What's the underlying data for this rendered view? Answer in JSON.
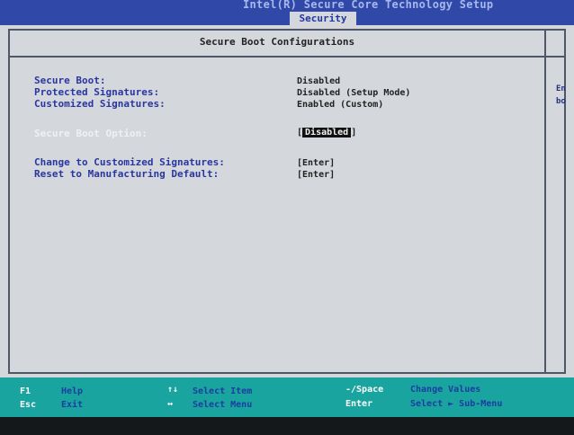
{
  "header": {
    "title": "Intel(R) Secure Core Technology Setup",
    "active_tab": "Security"
  },
  "section": {
    "title": "Secure Boot Configurations"
  },
  "info_rows": [
    {
      "label": "Secure Boot:",
      "value": "Disabled"
    },
    {
      "label": "Protected Signatures:",
      "value": "Disabled (Setup Mode)"
    },
    {
      "label": "Customized Signatures:",
      "value": "Enabled (Custom)"
    }
  ],
  "option_row": {
    "label": "Secure Boot Option:",
    "value": "Disabled"
  },
  "action_rows": [
    {
      "label": "Change to Customized Signatures:",
      "value": "[Enter]"
    },
    {
      "label": "Reset to Manufacturing Default:",
      "value": "[Enter]"
    }
  ],
  "help_panel": {
    "line1": "En",
    "line2": "bo"
  },
  "footer": {
    "items": [
      {
        "key": "F1",
        "desc": "Help"
      },
      {
        "key": "Esc",
        "desc": "Exit"
      },
      {
        "key": "↑↓",
        "desc": "Select Item"
      },
      {
        "key": "↔",
        "desc": "Select Menu"
      },
      {
        "key": "-/Space",
        "desc": "Change Values"
      },
      {
        "key": "Enter",
        "desc": "Select ► Sub-Menu"
      }
    ]
  },
  "colors": {
    "screen_bg": "#d4d8dc",
    "title_bar": "#3048a8",
    "label_blue": "#2a36a0",
    "footer_teal": "#1aa4a0"
  }
}
